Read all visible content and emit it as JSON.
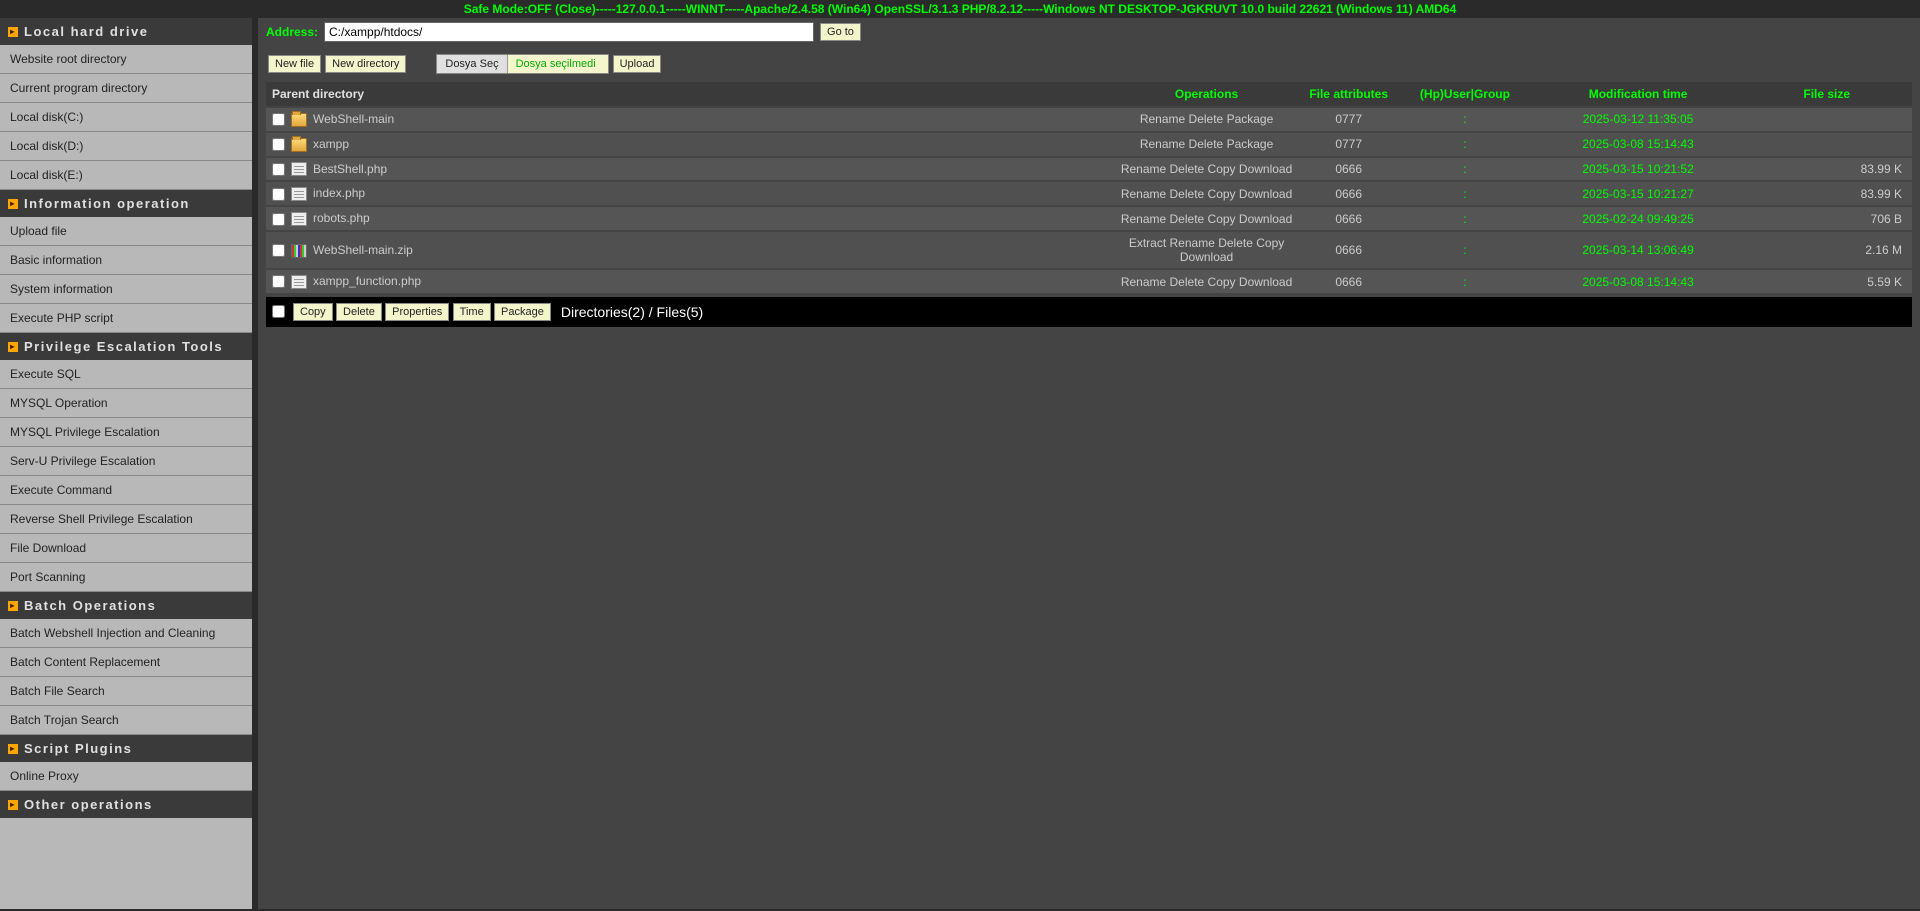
{
  "status_bar": {
    "safe_mode_label": "Safe Mode:",
    "safe_mode_value": "OFF",
    "close_label": "(Close)",
    "sep": "-----",
    "ip": "127.0.0.1",
    "os": "WINNT",
    "server": "Apache/2.4.58 (Win64) OpenSSL/3.1.3 PHP/8.2.12",
    "system": "Windows NT DESKTOP-JGKRUVT 10.0 build 22621 (Windows 11) AMD64"
  },
  "sidebar": {
    "sections": [
      {
        "title": "Local hard drive",
        "items": [
          "Website root directory",
          "Current program directory",
          "Local disk(C:)",
          "Local disk(D:)",
          "Local disk(E:)"
        ]
      },
      {
        "title": "Information operation",
        "items": [
          "Upload file",
          "Basic information",
          "System information",
          "Execute PHP script"
        ]
      },
      {
        "title": "Privilege Escalation Tools",
        "items": [
          "Execute SQL",
          "MYSQL Operation",
          "MYSQL Privilege Escalation",
          "Serv-U Privilege Escalation",
          "Execute Command",
          "Reverse Shell Privilege Escalation",
          "File Download",
          "Port Scanning"
        ]
      },
      {
        "title": "Batch Operations",
        "items": [
          "Batch Webshell Injection and Cleaning",
          "Batch Content Replacement",
          "Batch File Search",
          "Batch Trojan Search"
        ]
      },
      {
        "title": "Script Plugins",
        "items": [
          "Online Proxy"
        ]
      },
      {
        "title": "Other operations",
        "items": []
      }
    ]
  },
  "address": {
    "label": "Address:",
    "value": "C:/xampp/htdocs/",
    "go_button": "Go to"
  },
  "toolbar": {
    "new_file": "New file",
    "new_directory": "New directory",
    "file_select_button": "Dosya Seç",
    "file_select_status": "Dosya seçilmedi",
    "upload": "Upload"
  },
  "table": {
    "headers": {
      "name": "Parent directory",
      "operations": "Operations",
      "attributes": "File attributes",
      "usergroup": "(Hp)User|Group",
      "mtime": "Modification time",
      "size": "File size"
    },
    "rows": [
      {
        "type": "folder",
        "name": "WebShell-main",
        "ops": [
          "Rename",
          "Delete",
          "Package"
        ],
        "attr": "0777",
        "usergroup": ":",
        "mtime": "2025-03-12 11:35:05",
        "size": ""
      },
      {
        "type": "folder",
        "name": "xampp",
        "ops": [
          "Rename",
          "Delete",
          "Package"
        ],
        "attr": "0777",
        "usergroup": ":",
        "mtime": "2025-03-08 15:14:43",
        "size": ""
      },
      {
        "type": "file",
        "name": "BestShell.php",
        "ops": [
          "Rename",
          "Delete",
          "Copy",
          "Download"
        ],
        "attr": "0666",
        "usergroup": ":",
        "mtime": "2025-03-15 10:21:52",
        "size": "83.99 K"
      },
      {
        "type": "file",
        "name": "index.php",
        "ops": [
          "Rename",
          "Delete",
          "Copy",
          "Download"
        ],
        "attr": "0666",
        "usergroup": ":",
        "mtime": "2025-03-15 10:21:27",
        "size": "83.99 K"
      },
      {
        "type": "file",
        "name": "robots.php",
        "ops": [
          "Rename",
          "Delete",
          "Copy",
          "Download"
        ],
        "attr": "0666",
        "usergroup": ":",
        "mtime": "2025-02-24 09:49:25",
        "size": "706 B"
      },
      {
        "type": "zip",
        "name": "WebShell-main.zip",
        "ops": [
          "Extract",
          "Rename",
          "Delete",
          "Copy",
          "Download"
        ],
        "attr": "0666",
        "usergroup": ":",
        "mtime": "2025-03-14 13:06:49",
        "size": "2.16 M"
      },
      {
        "type": "file",
        "name": "xampp_function.php",
        "ops": [
          "Rename",
          "Delete",
          "Copy",
          "Download"
        ],
        "attr": "0666",
        "usergroup": ":",
        "mtime": "2025-03-08 15:14:43",
        "size": "5.59 K"
      }
    ]
  },
  "summary_bar": {
    "buttons": [
      "Copy",
      "Delete",
      "Properties",
      "Time",
      "Package"
    ],
    "text": "Directories(2) / Files(5)"
  }
}
